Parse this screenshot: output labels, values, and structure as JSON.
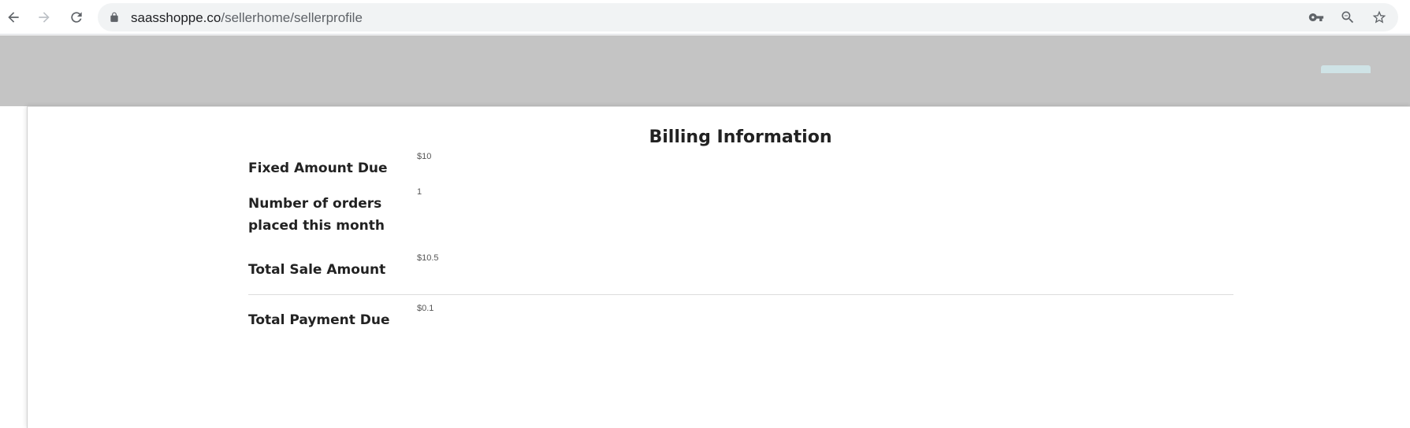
{
  "browser": {
    "url_host": "saasshoppe.co",
    "url_path": "/sellerhome/sellerprofile"
  },
  "modal": {
    "title": "Billing Information",
    "rows": [
      {
        "label": "Fixed Amount Due",
        "value": "$10"
      },
      {
        "label": "Number of orders placed this month",
        "value": "1"
      },
      {
        "label": "Total Sale Amount",
        "value": "$10.5"
      },
      {
        "label": "Total Payment Due",
        "value": "$0.1"
      }
    ]
  },
  "colors": {
    "backdrop": "#c4c4c4",
    "omnibox": "#f1f3f4",
    "text": "#222222"
  }
}
